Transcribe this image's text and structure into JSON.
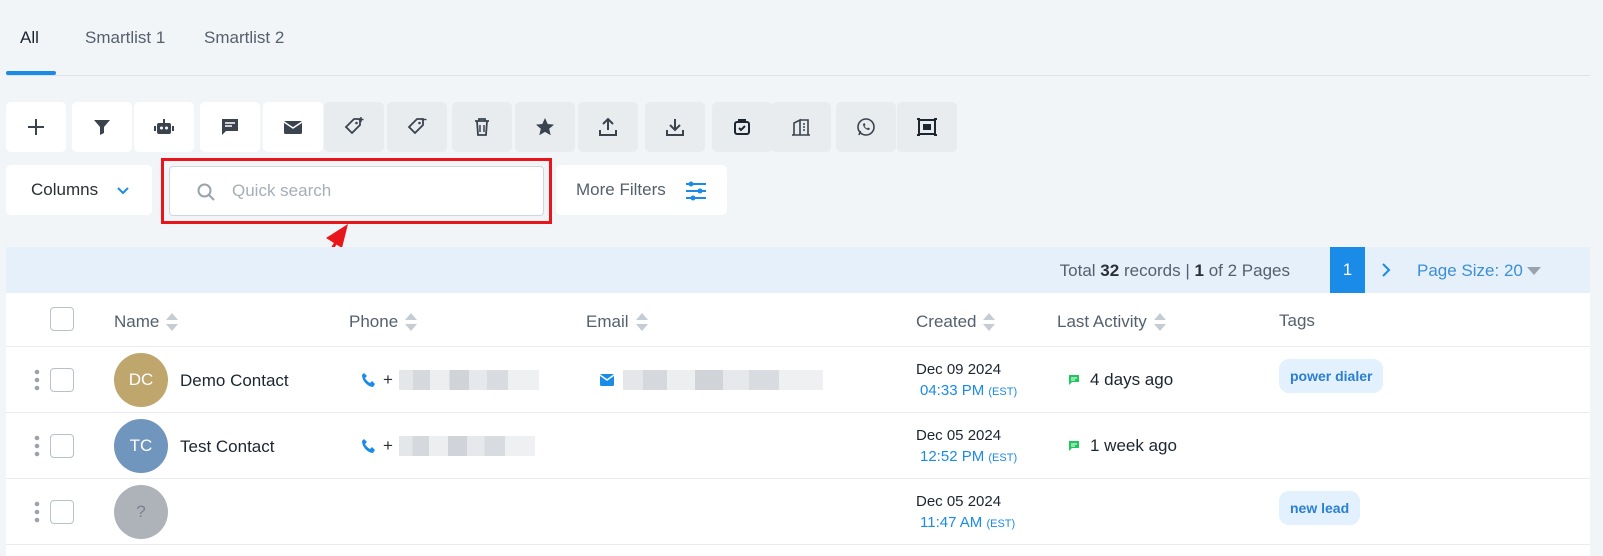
{
  "tabs": [
    {
      "label": "All",
      "active": true
    },
    {
      "label": "Smartlist 1",
      "active": false
    },
    {
      "label": "Smartlist 2",
      "active": false
    }
  ],
  "toolbar": {
    "buttons": [
      "add-icon",
      "filter-icon",
      "robot-icon",
      "sms-icon",
      "email-icon",
      "add-tag-icon",
      "remove-tag-icon",
      "delete-icon",
      "star-icon",
      "export-icon",
      "import-icon",
      "review-icon",
      "company-icon",
      "whatsapp-icon",
      "qr-icon"
    ]
  },
  "controls": {
    "columns_label": "Columns",
    "search_placeholder": "Quick search",
    "more_filters_label": "More Filters"
  },
  "pager": {
    "total_prefix": "Total",
    "total_count": "32",
    "records_word": "records |",
    "current_page": "1",
    "pages_text": "of 2 Pages",
    "page_size_label": "Page Size: 20"
  },
  "columns": [
    "Name",
    "Phone",
    "Email",
    "Created",
    "Last Activity",
    "Tags"
  ],
  "rows": [
    {
      "initials": "DC",
      "avatar_color": "#bfa66d",
      "name": "Demo Contact",
      "phone_prefix": "+",
      "has_email": true,
      "created_date": "Dec 09 2024",
      "created_time": "04:33 PM",
      "tz": "(EST)",
      "activity": "4 days ago",
      "tag": "power dialer"
    },
    {
      "initials": "TC",
      "avatar_color": "#7196bd",
      "name": "Test Contact",
      "phone_prefix": "+",
      "has_email": false,
      "created_date": "Dec 05 2024",
      "created_time": "12:52 PM",
      "tz": "(EST)",
      "activity": "1 week ago",
      "tag": ""
    },
    {
      "initials": "?",
      "avatar_color": "#aeb3ba",
      "name": "",
      "phone_prefix": "",
      "has_email": false,
      "created_date": "Dec 05 2024",
      "created_time": "11:47 AM",
      "tz": "(EST)",
      "activity": "",
      "tag": "new lead"
    }
  ],
  "colors": {
    "accent": "#1a8be6",
    "highlight": "#e8151b",
    "activity_icon": "#22c55e"
  }
}
